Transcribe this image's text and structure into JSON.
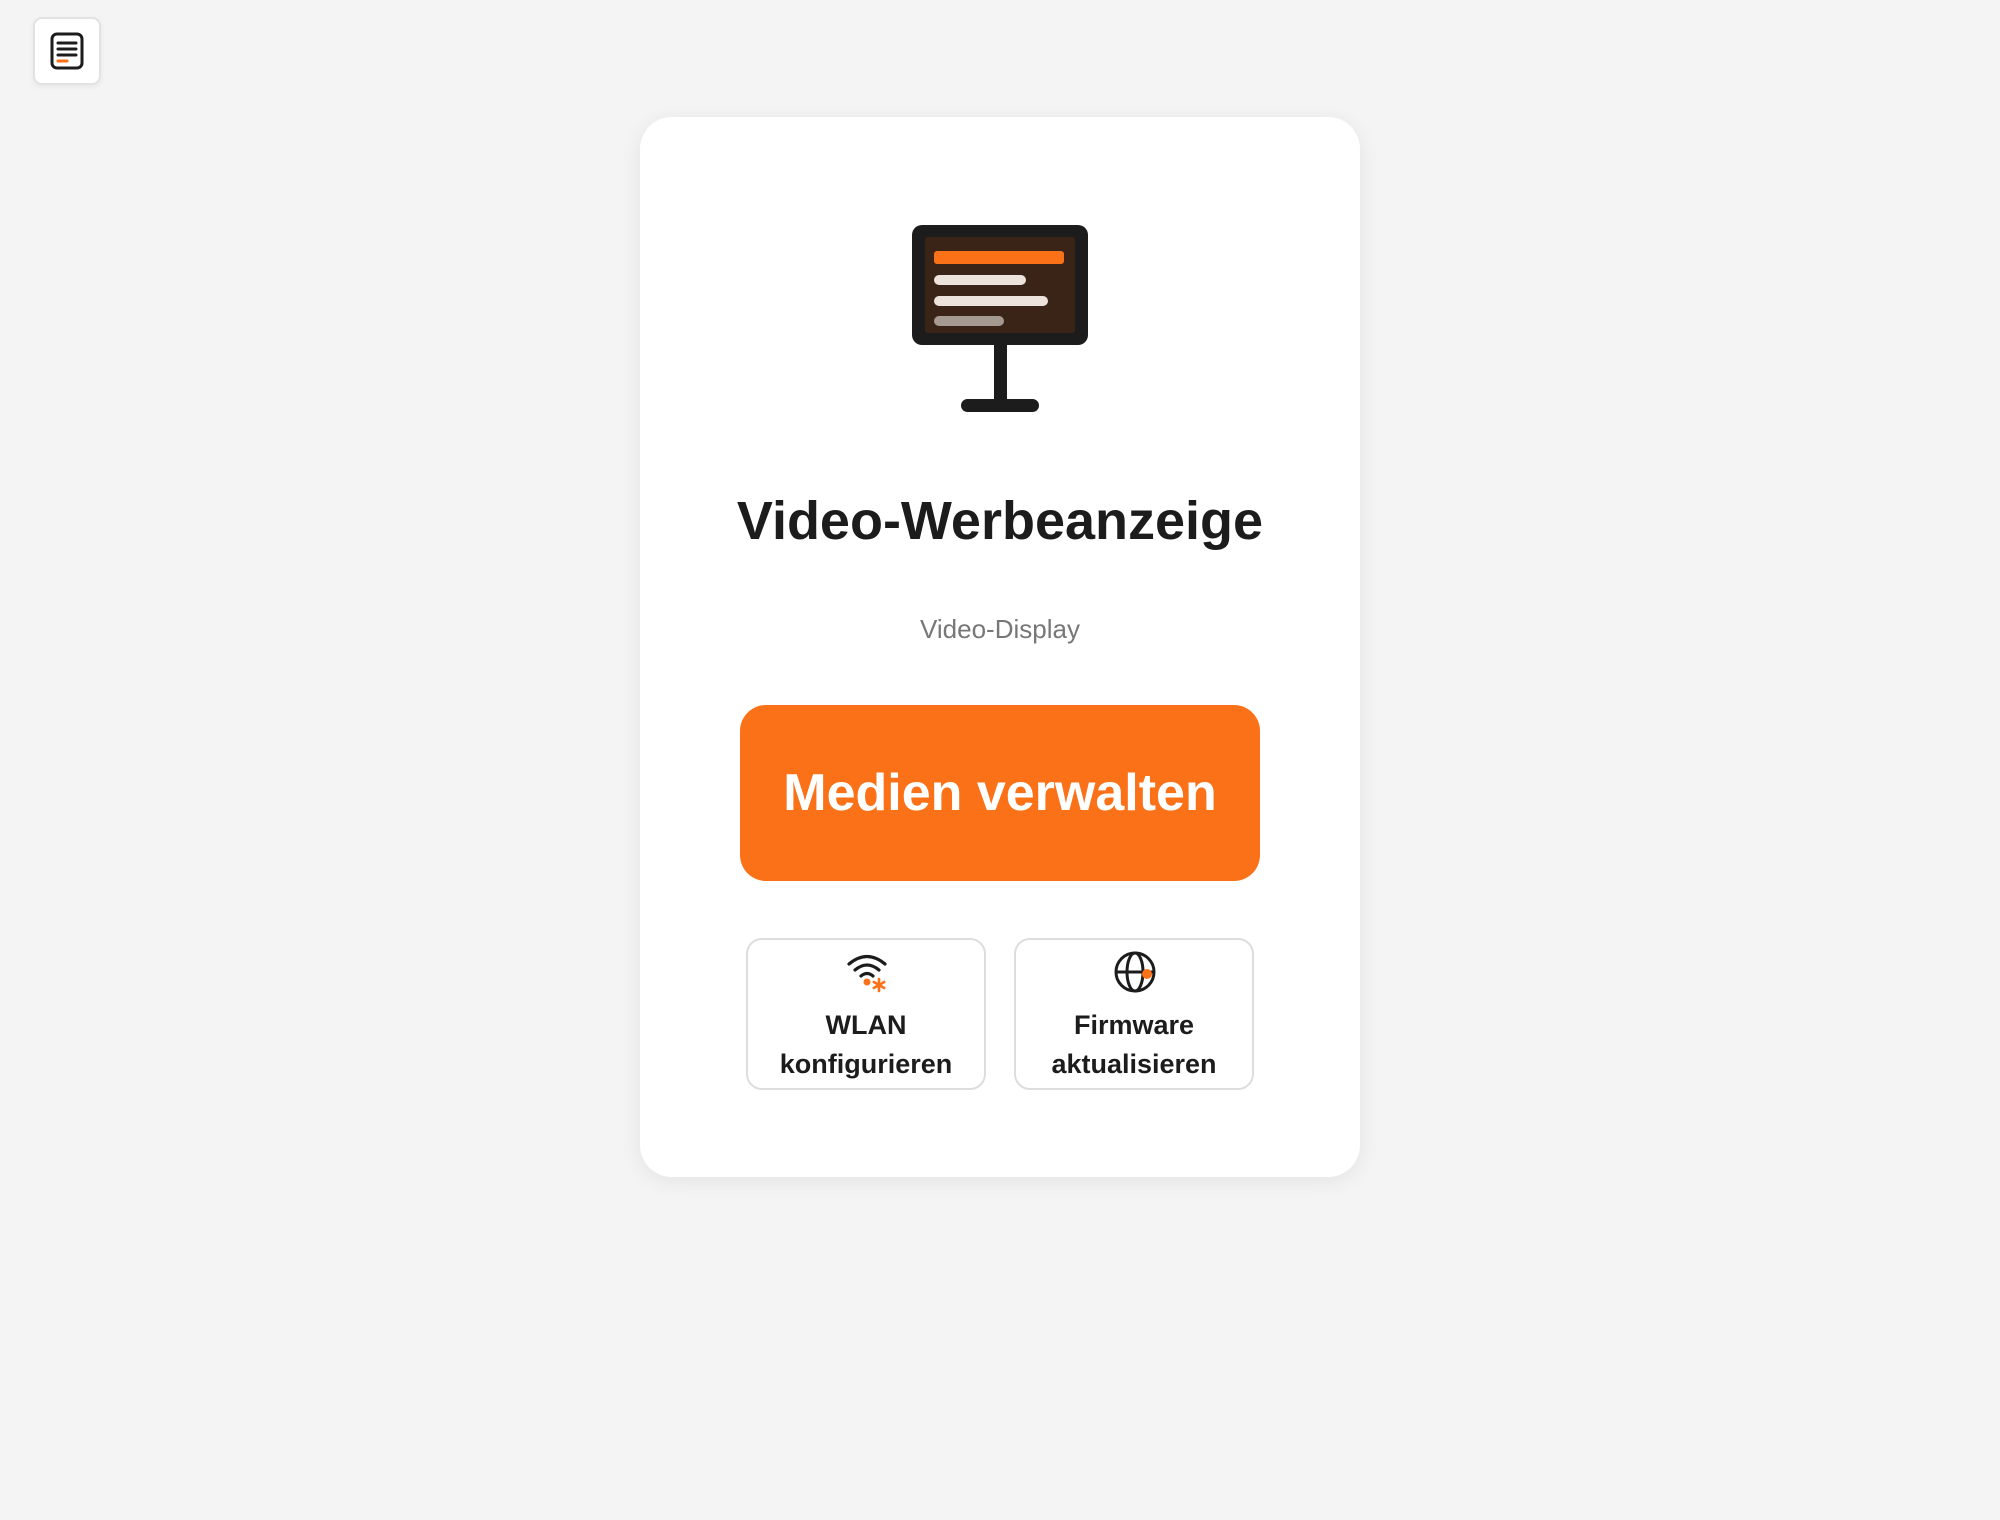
{
  "menu": {
    "icon": "document-list-icon"
  },
  "device": {
    "icon": "video-display-monitor-icon",
    "name": "Video-Werbeanzeige",
    "type": "Video-Display"
  },
  "actions": {
    "primary_label": "Medien verwalten",
    "wlan_label": "WLAN\nkonfigurieren",
    "wlan_icon": "wifi-settings-icon",
    "firmware_label": "Firmware\naktualisieren",
    "firmware_icon": "globe-update-icon"
  },
  "colors": {
    "accent": "#fb7118",
    "background": "#f4f4f4",
    "card": "#ffffff",
    "text": "#1c1c1c",
    "muted_text": "#777777"
  }
}
